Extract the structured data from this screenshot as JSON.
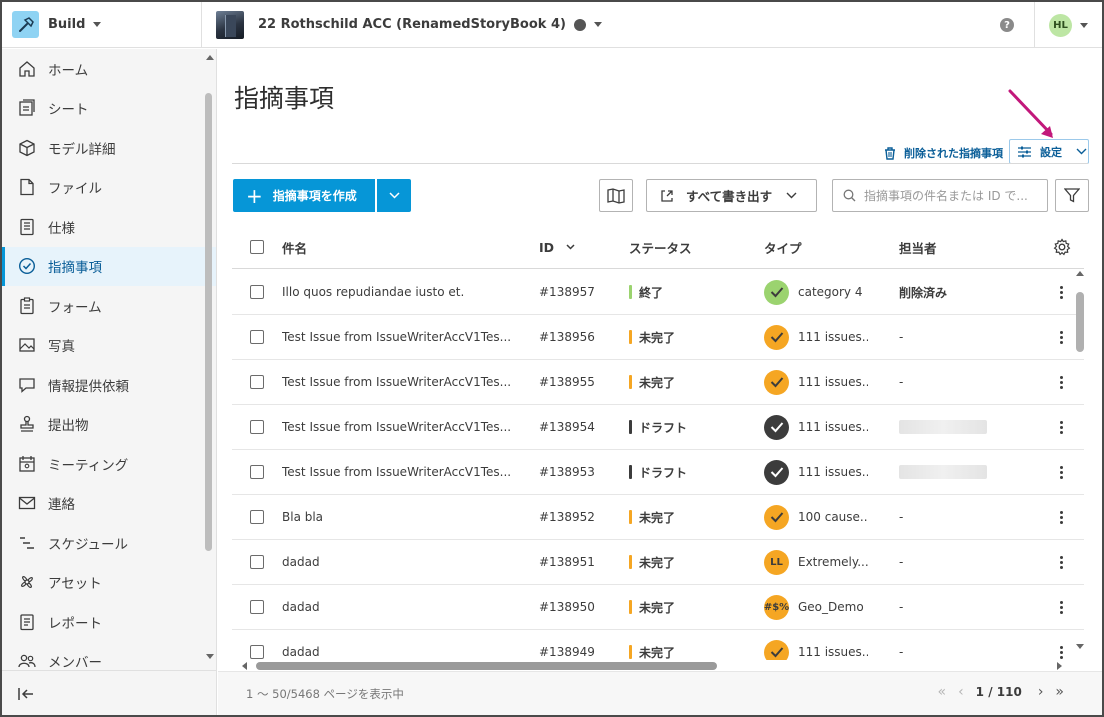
{
  "app": {
    "name": "Build"
  },
  "project": {
    "name": "22 Rothschild ACC (RenamedStoryBook 4)"
  },
  "user": {
    "initials": "HL"
  },
  "help": {
    "glyph": "?"
  },
  "sidebar": {
    "items": [
      {
        "label": "ホーム",
        "icon": "home-icon",
        "active": false
      },
      {
        "label": "シート",
        "icon": "sheets-icon",
        "active": false
      },
      {
        "label": "モデル詳細",
        "icon": "cube-icon",
        "active": false
      },
      {
        "label": "ファイル",
        "icon": "file-icon",
        "active": false
      },
      {
        "label": "仕様",
        "icon": "spec-icon",
        "active": false
      },
      {
        "label": "指摘事項",
        "icon": "issue-icon",
        "active": true
      },
      {
        "label": "フォーム",
        "icon": "form-icon",
        "active": false
      },
      {
        "label": "写真",
        "icon": "photo-icon",
        "active": false
      },
      {
        "label": "情報提供依頼",
        "icon": "rfi-icon",
        "active": false
      },
      {
        "label": "提出物",
        "icon": "stamp-icon",
        "active": false
      },
      {
        "label": "ミーティング",
        "icon": "meeting-icon",
        "active": false
      },
      {
        "label": "連絡",
        "icon": "mail-icon",
        "active": false
      },
      {
        "label": "スケジュール",
        "icon": "schedule-icon",
        "active": false
      },
      {
        "label": "アセット",
        "icon": "asset-icon",
        "active": false
      },
      {
        "label": "レポート",
        "icon": "report-icon",
        "active": false
      },
      {
        "label": "メンバー",
        "icon": "members-icon",
        "active": false
      }
    ]
  },
  "page": {
    "title": "指摘事項"
  },
  "header_actions": {
    "deleted_label": "削除された指摘事項",
    "settings_label": "設定"
  },
  "toolbar": {
    "create_label": "指摘事項を作成",
    "create_plus": "+",
    "export_label": "すべて書き出す",
    "search_placeholder": "指摘事項の件名または ID で..."
  },
  "table": {
    "columns": {
      "name": "件名",
      "id": "ID",
      "status": "ステータス",
      "type": "タイプ",
      "assignee": "担当者"
    },
    "rows": [
      {
        "name": "Illo quos repudiandae iusto et.",
        "id": "#138957",
        "status": "終了",
        "status_color": "#9bd36f",
        "type_badge": "check",
        "badge_color": "#9bd36f",
        "type": "category 4",
        "assignee": "削除済み",
        "assignee_blur": false
      },
      {
        "name": "Test Issue from IssueWriterAccV1Tes...",
        "id": "#138956",
        "status": "未完了",
        "status_color": "#f5a623",
        "type_badge": "check",
        "badge_color": "#f5a623",
        "type": "111 issues...",
        "assignee": "-",
        "assignee_blur": false
      },
      {
        "name": "Test Issue from IssueWriterAccV1Tes...",
        "id": "#138955",
        "status": "未完了",
        "status_color": "#f5a623",
        "type_badge": "check",
        "badge_color": "#f5a623",
        "type": "111 issues...",
        "assignee": "-",
        "assignee_blur": false
      },
      {
        "name": "Test Issue from IssueWriterAccV1Tes...",
        "id": "#138954",
        "status": "ドラフト",
        "status_color": "#3c3c3c",
        "type_badge": "check-dark",
        "badge_color": "#3c3c3c",
        "type": "111 issues...",
        "assignee": "",
        "assignee_blur": true
      },
      {
        "name": "Test Issue from IssueWriterAccV1Tes...",
        "id": "#138953",
        "status": "ドラフト",
        "status_color": "#3c3c3c",
        "type_badge": "check-dark",
        "badge_color": "#3c3c3c",
        "type": "111 issues...",
        "assignee": "",
        "assignee_blur": true
      },
      {
        "name": "Bla bla",
        "id": "#138952",
        "status": "未完了",
        "status_color": "#f5a623",
        "type_badge": "check",
        "badge_color": "#f5a623",
        "type": "100 cause...",
        "assignee": "-",
        "assignee_blur": false
      },
      {
        "name": "dadad",
        "id": "#138951",
        "status": "未完了",
        "status_color": "#f5a623",
        "type_badge": "LL",
        "badge_color": "#f5a623",
        "type": "Extremely...",
        "assignee": "-",
        "assignee_blur": false
      },
      {
        "name": "dadad",
        "id": "#138950",
        "status": "未完了",
        "status_color": "#f5a623",
        "type_badge": "#$%",
        "badge_color": "#f5a623",
        "type": "Geo_Demo",
        "assignee": "-",
        "assignee_blur": false
      },
      {
        "name": "dadad",
        "id": "#138949",
        "status": "未完了",
        "status_color": "#f5a623",
        "type_badge": "check",
        "badge_color": "#f5a623",
        "type": "111 issues...",
        "assignee": "-",
        "assignee_blur": false
      }
    ]
  },
  "footer": {
    "range_text": "1 ～ 50/5468 ページを表示中",
    "page_indicator": "1 / 110",
    "first": "«",
    "prev": "‹",
    "next": "›",
    "last": "»"
  },
  "colors": {
    "accent": "#0696d7",
    "link": "#0a5e98",
    "annotation": "#c2187b"
  }
}
